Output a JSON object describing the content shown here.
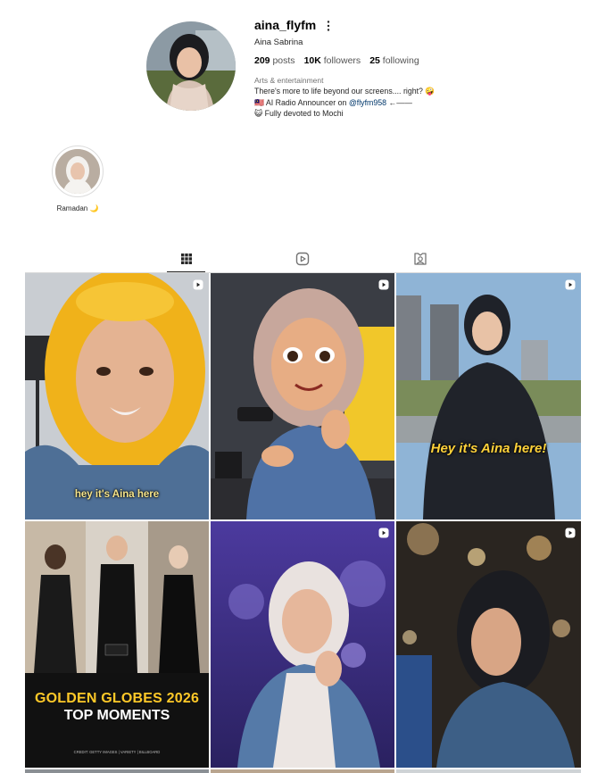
{
  "profile": {
    "username": "aina_flyfm",
    "full_name": "Aina Sabrina",
    "stats": {
      "posts_count": "209",
      "posts_label": "posts",
      "followers_count": "10K",
      "followers_label": "followers",
      "following_count": "25",
      "following_label": "following"
    },
    "category": "Arts & entertainment",
    "bio": {
      "line1": "There's more to life beyond our screens.... right? 🤪",
      "line2_prefix": "🇲🇾 AI Radio Announcer on ",
      "line2_link": "@flyfm958",
      "line2_suffix": " ←——",
      "line3": "😺 Fully devoted to Mochi"
    }
  },
  "highlights": [
    {
      "label": "Ramadan 🌙"
    }
  ],
  "tabs": [
    {
      "icon": "grid-icon",
      "active": true
    },
    {
      "icon": "reels-icon",
      "active": false
    },
    {
      "icon": "tagged-icon",
      "active": false
    }
  ],
  "posts": [
    {
      "caption": "hey it's Aina here",
      "type": "reel"
    },
    {
      "caption": "",
      "type": "reel"
    },
    {
      "caption": "Hey it's Aina here!",
      "type": "reel"
    },
    {
      "caption_line1": "GOLDEN GLOBES 2026",
      "caption_line2": "TOP MOMENTS",
      "credit": "CREDIT: GETTY IMAGES | VARIETY | BILLBOARD",
      "type": "post"
    },
    {
      "caption": "",
      "type": "reel"
    },
    {
      "caption": "",
      "type": "reel"
    }
  ],
  "colors": {
    "link": "#00376b",
    "muted": "#737373",
    "border": "#dbdbdb"
  }
}
